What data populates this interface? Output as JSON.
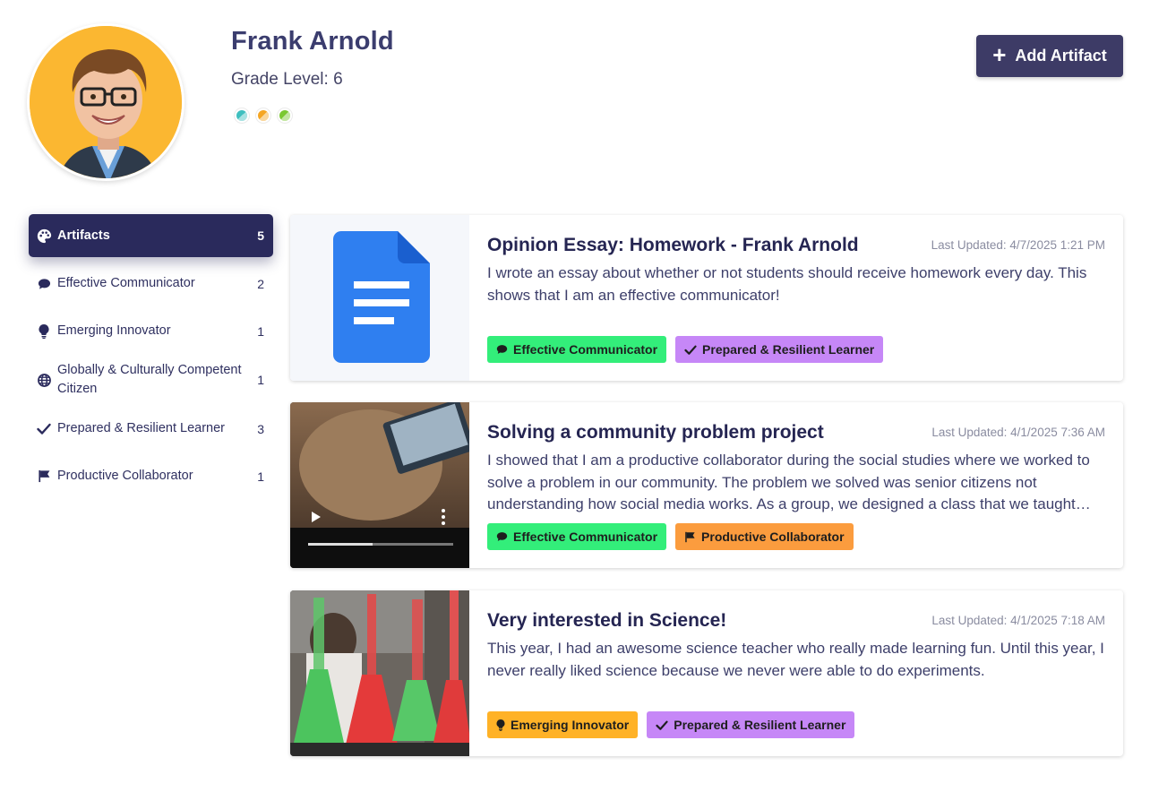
{
  "student": {
    "name": "Frank Arnold",
    "grade": "Grade Level: 6",
    "dots": [
      "#3fbfbf",
      "#f5a623",
      "#7bc832"
    ]
  },
  "header": {
    "add_button": "Add Artifact",
    "add_icon": "plus-icon"
  },
  "sidebar": {
    "items": [
      {
        "label": "Artifacts",
        "count": "5",
        "icon": "palette-icon",
        "active": true
      },
      {
        "label": "Effective Communicator",
        "count": "2",
        "icon": "speech-bubble-icon"
      },
      {
        "label": "Emerging Innovator",
        "count": "1",
        "icon": "lightbulb-icon"
      },
      {
        "label": "Globally & Culturally Competent Citizen",
        "count": "1",
        "icon": "globe-icon"
      },
      {
        "label": "Prepared & Resilient Learner",
        "count": "3",
        "icon": "checkmark-icon"
      },
      {
        "label": "Productive Collaborator",
        "count": "1",
        "icon": "flag-icon"
      }
    ]
  },
  "artifacts": [
    {
      "title": "Opinion Essay: Homework - Frank Arnold",
      "updated": "Last Updated: 4/7/2025 1:21 PM",
      "description": "I wrote an essay about whether or not students should receive homework every day. This shows that I am an effective communicator!",
      "thumbnail": "google-docs-icon",
      "tags": [
        {
          "label": "Effective Communicator",
          "color": "#33ee7a",
          "icon": "speech-bubble-icon"
        },
        {
          "label": "Prepared & Resilient Learner",
          "color": "#c687f7",
          "icon": "checkmark-icon"
        }
      ]
    },
    {
      "title": "Solving a community problem project",
      "updated": "Last Updated: 4/1/2025 7:36 AM",
      "description": "I showed that I am a productive collaborator during the social studies where we worked to solve a problem in our community. The problem we solved was senior citizens not understanding how social media works. As a group, we designed a class that we taught senior citizens how to use social media.",
      "thumbnail": "video-thumbnail",
      "tags": [
        {
          "label": "Effective Communicator",
          "color": "#33ee7a",
          "icon": "speech-bubble-icon"
        },
        {
          "label": "Productive Collaborator",
          "color": "#fb9c3e",
          "icon": "flag-icon"
        }
      ]
    },
    {
      "title": "Very interested in Science!",
      "updated": "Last Updated: 4/1/2025 7:18 AM",
      "description": "This year, I had an awesome science teacher who really made learning fun. Until this year, I never really liked science because we never were able to do experiments.",
      "thumbnail": "science-photo",
      "tags": [
        {
          "label": "Emerging Innovator",
          "color": "#ffb227",
          "icon": "lightbulb-icon"
        },
        {
          "label": "Prepared & Resilient Learner",
          "color": "#c687f7",
          "icon": "checkmark-icon"
        }
      ]
    }
  ]
}
